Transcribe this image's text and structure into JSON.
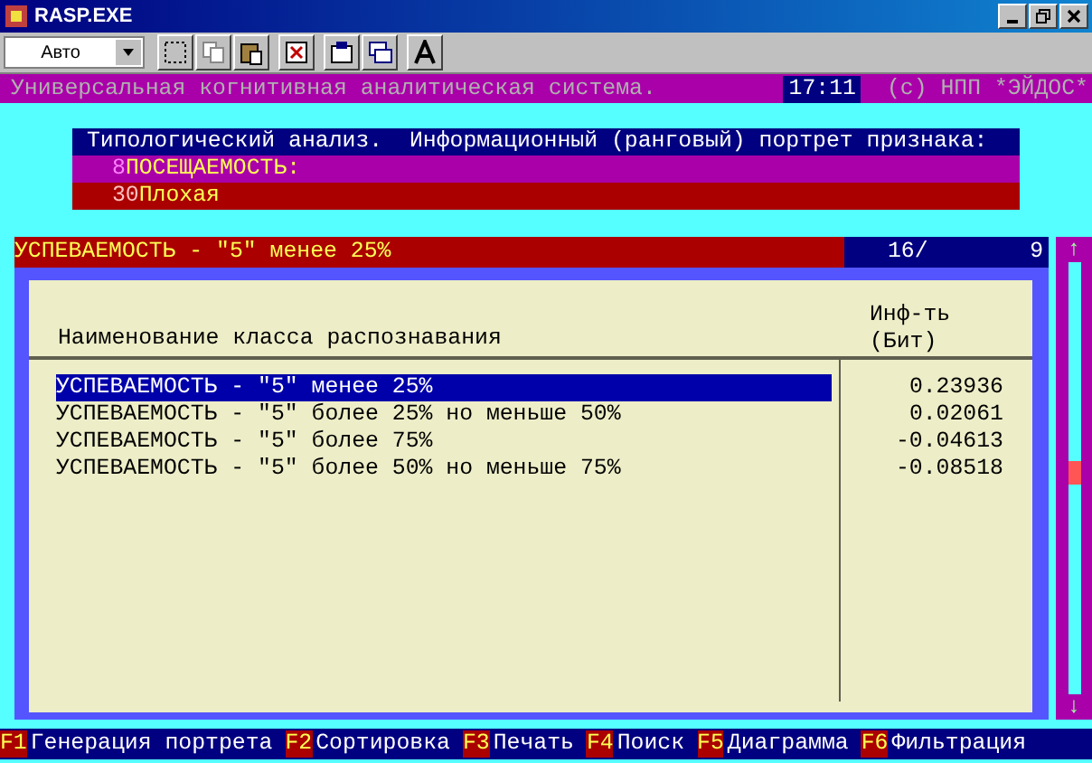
{
  "window": {
    "title": "RASP.EXE"
  },
  "toolbar": {
    "font_size": "Авто"
  },
  "header": {
    "title": "Универсальная когнитивная аналитическая система.",
    "clock": "17:11",
    "copyright": "(c) НПП *ЭЙДОС*"
  },
  "panel": {
    "title": "Типологический анализ.  Информационный (ранговый) портрет признака:",
    "rows": [
      {
        "kind": "attribute",
        "number": "8",
        "text": "ПОСЕЩАЕМОСТЬ:"
      },
      {
        "kind": "value",
        "number": "30",
        "text": "Плохая"
      }
    ]
  },
  "current": {
    "text": "УСПЕВАЕМОСТЬ - \"5\" менее 25%",
    "position": "16/",
    "total": "9"
  },
  "table": {
    "columns": [
      [
        "Наименование класса распознавания"
      ],
      [
        "Инф-ть",
        "(Бит)"
      ]
    ],
    "rows": [
      {
        "name": "УСПЕВАЕМОСТЬ - \"5\" менее 25%",
        "value": "0.23936",
        "selected": true
      },
      {
        "name": "УСПЕВАЕМОСТЬ - \"5\" более 25% но меньше 50%",
        "value": "0.02061",
        "selected": false
      },
      {
        "name": "УСПЕВАЕМОСТЬ - \"5\" более 75%",
        "value": "-0.04613",
        "selected": false
      },
      {
        "name": "УСПЕВАЕМОСТЬ - \"5\" более 50% но меньше 75%",
        "value": "-0.08518",
        "selected": false
      }
    ]
  },
  "scroll": {
    "up": "↑",
    "down": "↓"
  },
  "function_keys": [
    {
      "key": "F1",
      "label": "Генерация портрета"
    },
    {
      "key": "F2",
      "label": "Сортировка"
    },
    {
      "key": "F3",
      "label": "Печать"
    },
    {
      "key": "F4",
      "label": "Поиск"
    },
    {
      "key": "F5",
      "label": "Диаграмма"
    },
    {
      "key": "F6",
      "label": "Фильтрация"
    }
  ]
}
